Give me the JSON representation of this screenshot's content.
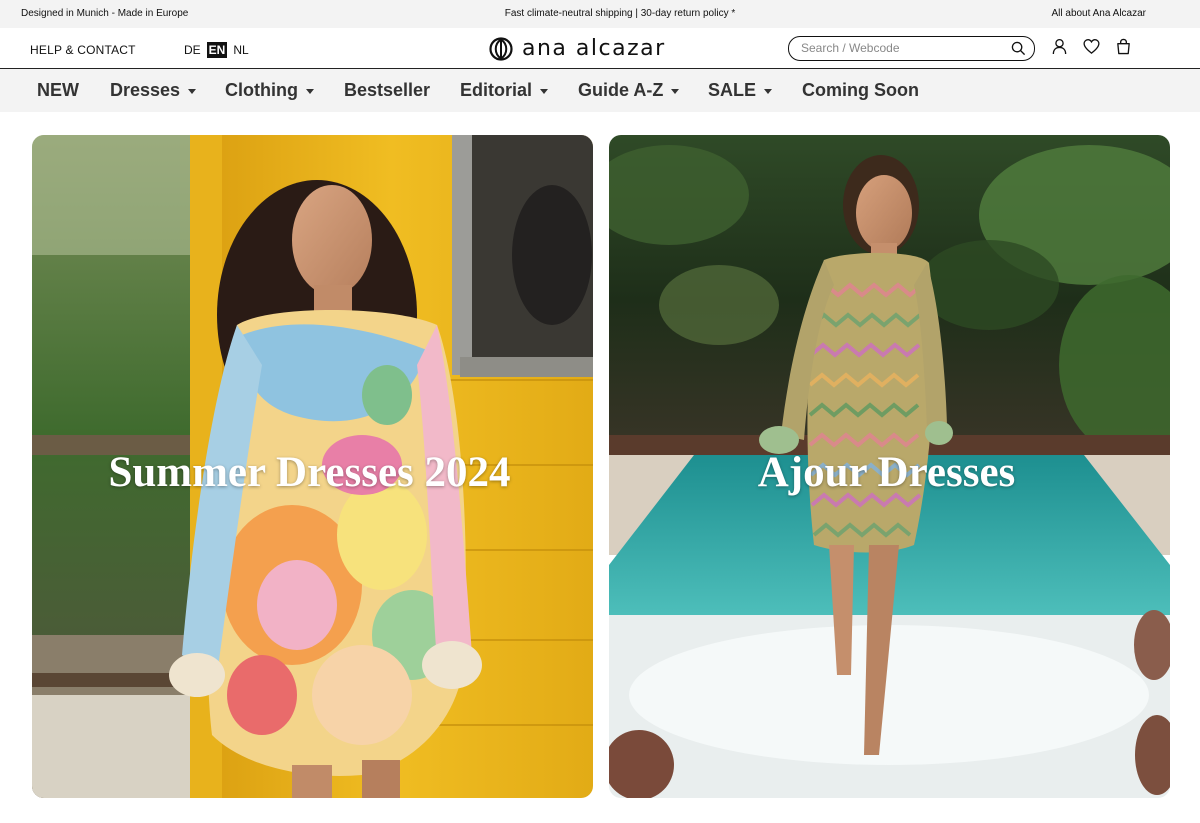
{
  "topbar": {
    "left": "Designed in Munich - Made in Europe",
    "center": "Fast climate-neutral shipping | 30-day return policy *",
    "right": "All about Ana Alcazar"
  },
  "header": {
    "help": "HELP & CONTACT",
    "languages": [
      "DE",
      "EN",
      "NL"
    ],
    "active_language": "EN",
    "logo": "ana alcazar",
    "search_placeholder": "Search / Webcode",
    "icons": [
      "account-icon",
      "wishlist-heart-icon",
      "shopping-bag-icon"
    ]
  },
  "nav": {
    "items": [
      {
        "label": "NEW",
        "dropdown": false
      },
      {
        "label": "Dresses",
        "dropdown": true
      },
      {
        "label": "Clothing",
        "dropdown": true
      },
      {
        "label": "Bestseller",
        "dropdown": false
      },
      {
        "label": "Editorial",
        "dropdown": true
      },
      {
        "label": "Guide A-Z",
        "dropdown": true
      },
      {
        "label": "SALE",
        "dropdown": true
      },
      {
        "label": "Coming Soon",
        "dropdown": false
      }
    ]
  },
  "hero": {
    "tiles": [
      {
        "title": "Summer Dresses 2024"
      },
      {
        "title": "Ajour Dresses"
      }
    ]
  },
  "colors": {
    "topbar_bg": "#f3f3f3",
    "nav_bg": "#f3f3f3",
    "nav_text": "#333333",
    "active_lang_bg": "#111111",
    "wall_yellow": "#e7b31d",
    "pool_teal": "#3bb8b5"
  }
}
